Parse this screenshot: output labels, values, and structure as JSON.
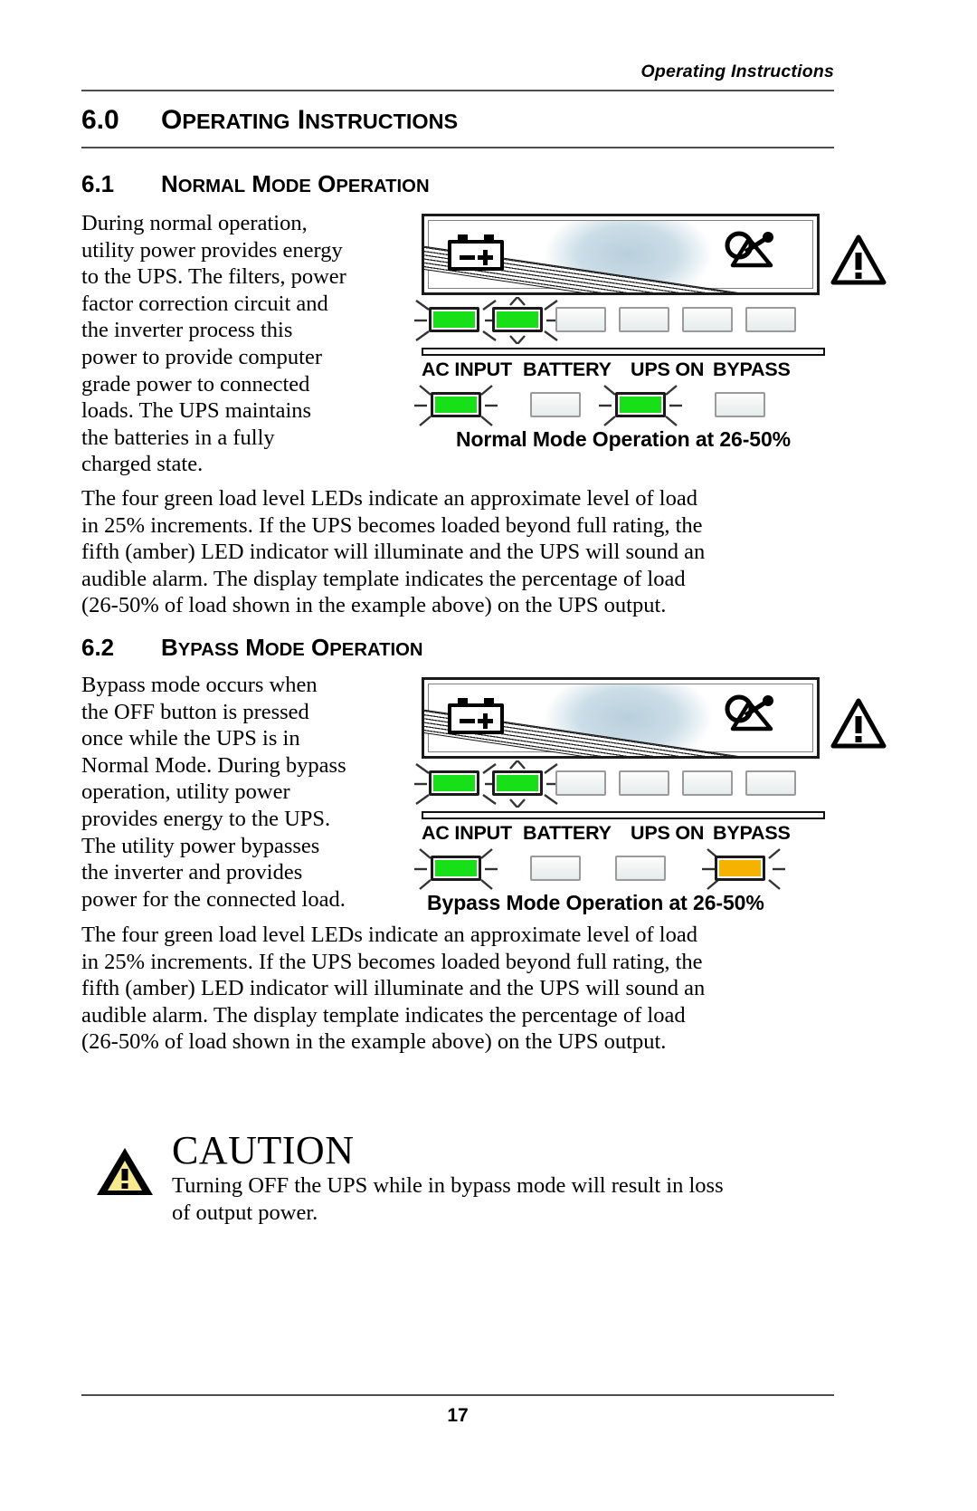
{
  "header": {
    "running_head": "Operating Instructions"
  },
  "footer": {
    "page_number": "17"
  },
  "sections": {
    "s60": {
      "number": "6.0",
      "title": "Operating Instructions"
    },
    "s61": {
      "number": "6.1",
      "title": "Normal Mode Operation"
    },
    "s62": {
      "number": "6.2",
      "title": "Bypass Mode Operation"
    }
  },
  "paragraphs": {
    "normal_intro": [
      "During normal operation,",
      "utility power provides energy",
      "to the UPS. The filters, power",
      "factor correction circuit and",
      "the inverter process this",
      "power to provide computer",
      "grade power to connected",
      "loads. The UPS maintains",
      "the batteries in a fully",
      "charged state."
    ],
    "leds_note_1": [
      "The four green load level LEDs indicate an approximate level of load",
      "in 25% increments. If the UPS becomes loaded beyond full rating, the",
      "fifth (amber) LED indicator will illuminate and the UPS will sound an",
      "audible alarm. The display template indicates the percentage of load",
      "(26-50% of load shown in the example above) on the UPS output."
    ],
    "bypass_intro": [
      "Bypass mode occurs when",
      "the OFF button is pressed",
      "once while the UPS is in",
      "Normal Mode. During bypass",
      "operation, utility power",
      "provides energy to the UPS.",
      "The utility power bypasses",
      "the inverter and provides",
      "power for the connected load."
    ],
    "leds_note_2": [
      "The four green load level LEDs indicate an approximate level of load",
      "in 25% increments. If the UPS becomes loaded beyond full rating, the",
      "fifth (amber) LED indicator will illuminate and the UPS will sound an",
      "audible alarm. The display template indicates the percentage of load",
      "(26-50% of load shown in the example above) on the UPS output."
    ]
  },
  "caution": {
    "word": "CAUTION",
    "lines": [
      "Turning OFF the UPS while in bypass mode will result in loss",
      "of output power."
    ]
  },
  "figures": {
    "normal_mode": {
      "caption": "Normal Mode Operation at 26-50%",
      "status_labels": [
        "AC INPUT",
        "BATTERY",
        "UPS ON",
        "BYPASS"
      ],
      "status_leds": [
        {
          "name": "AC INPUT",
          "state": "on",
          "color": "#18e018",
          "blinking": true
        },
        {
          "name": "BATTERY",
          "state": "off",
          "color": "#eef2f2",
          "blinking": false
        },
        {
          "name": "UPS ON",
          "state": "on",
          "color": "#18e018",
          "blinking": true
        },
        {
          "name": "BYPASS",
          "state": "off",
          "color": "#eef2f2",
          "blinking": false
        }
      ],
      "load_leds": [
        {
          "index": 1,
          "state": "on",
          "color": "#18e018",
          "blinking": true
        },
        {
          "index": 2,
          "state": "on",
          "color": "#18e018",
          "blinking": true
        },
        {
          "index": 3,
          "state": "off",
          "color": "#eef2f2",
          "blinking": false
        },
        {
          "index": 4,
          "state": "off",
          "color": "#eef2f2",
          "blinking": false
        },
        {
          "index": 5,
          "state": "off",
          "color": "#eef2f2",
          "blinking": false
        },
        {
          "index": 6,
          "state": "off",
          "color": "#eef2f2",
          "blinking": false
        }
      ]
    },
    "bypass_mode": {
      "caption": "Bypass Mode Operation at 26-50%",
      "status_labels": [
        "AC INPUT",
        "BATTERY",
        "UPS ON",
        "BYPASS"
      ],
      "status_leds": [
        {
          "name": "AC INPUT",
          "state": "on",
          "color": "#18e018",
          "blinking": true
        },
        {
          "name": "BATTERY",
          "state": "off",
          "color": "#eef2f2",
          "blinking": false
        },
        {
          "name": "UPS ON",
          "state": "off",
          "color": "#eef2f2",
          "blinking": false
        },
        {
          "name": "BYPASS",
          "state": "amber",
          "color": "#f5b300",
          "blinking": true
        }
      ],
      "load_leds": [
        {
          "index": 1,
          "state": "on",
          "color": "#18e018",
          "blinking": true
        },
        {
          "index": 2,
          "state": "on",
          "color": "#18e018",
          "blinking": true
        },
        {
          "index": 3,
          "state": "off",
          "color": "#eef2f2",
          "blinking": false
        },
        {
          "index": 4,
          "state": "off",
          "color": "#eef2f2",
          "blinking": false
        },
        {
          "index": 5,
          "state": "off",
          "color": "#eef2f2",
          "blinking": false
        },
        {
          "index": 6,
          "state": "off",
          "color": "#eef2f2",
          "blinking": false
        }
      ]
    }
  },
  "colors": {
    "led_green": "#18e018",
    "led_amber": "#f5b300",
    "led_off": "#eef2f2",
    "caution_yellow": "#f7e98e",
    "rule": "#4d4d4d"
  }
}
